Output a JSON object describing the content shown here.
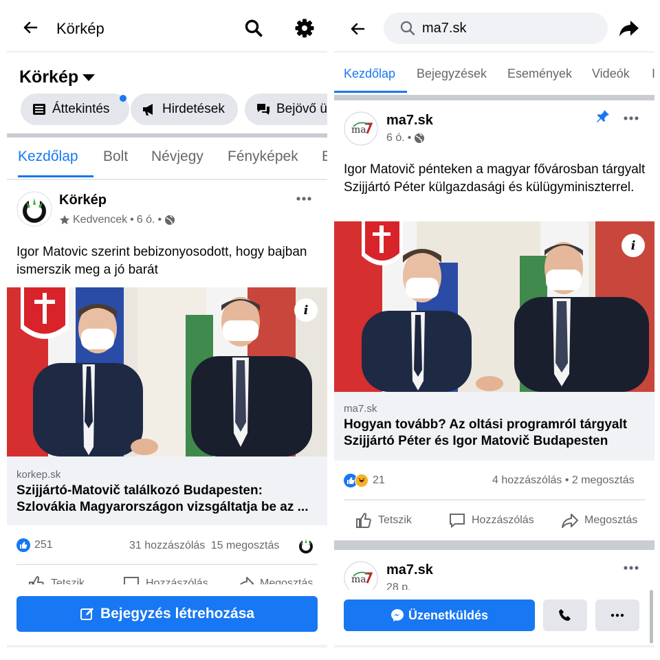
{
  "left": {
    "topbar": {
      "title": "Körkép"
    },
    "page_header": {
      "name": "Körkép"
    },
    "chips": [
      {
        "label": "Áttekintés",
        "icon": "dashboard-icon"
      },
      {
        "label": "Hirdetések",
        "icon": "megaphone-icon"
      },
      {
        "label": "Bejövő ü",
        "icon": "chat-icon"
      }
    ],
    "tabs": [
      "Kezdőlap",
      "Bolt",
      "Névjegy",
      "Fényképek",
      "E"
    ],
    "post": {
      "author": "Körkép",
      "favorite_label": "Kedvencek",
      "time": "6 ó.",
      "text": "Igor Matovic szerint bebizonyosodott, hogy bajban ismerszik meg a jó barát",
      "link_domain": "korkep.sk",
      "link_title_line1": "Szijjártó-Matovič találkozó Budapesten:",
      "link_title_line2": "Szlovákia Magyarországon vizsgáltatja be az ...",
      "reaction_count": "251",
      "comments": "31 hozzászólás",
      "shares": "15 megosztás",
      "actions": [
        "Tetszik",
        "Hozzászólás",
        "Megosztás"
      ]
    },
    "create_post_button": "Bejegyzés létrehozása"
  },
  "right": {
    "search": {
      "value": "ma7.sk"
    },
    "tabs": [
      "Kezdőlap",
      "Bejegyzések",
      "Események",
      "Videók",
      "I"
    ],
    "post": {
      "author": "ma7.sk",
      "time": "6 ó.",
      "text": "Igor Matovič pénteken a magyar fővárosban tárgyalt Szijjártó Péter külgazdasági és külügyminiszterrel.",
      "link_domain": "ma7.sk",
      "link_title_line1": "Hogyan tovább? Az oltási programról tárgyalt",
      "link_title_line2": "Szijjártó Péter és Igor Matovič Budapesten",
      "reaction_count": "21",
      "comments_shares": "4 hozzászólás • 2 megosztás",
      "actions": [
        "Tetszik",
        "Hozzászólás",
        "Megosztás"
      ]
    },
    "next_post": {
      "author": "ma7.sk",
      "time": "28 p."
    },
    "message_button": "Üzenetküldés"
  },
  "colors": {
    "brand_blue": "#1877f2",
    "text_secondary": "#65676b",
    "chip_bg": "#e4e6eb",
    "link_bg": "#f0f2f5"
  }
}
